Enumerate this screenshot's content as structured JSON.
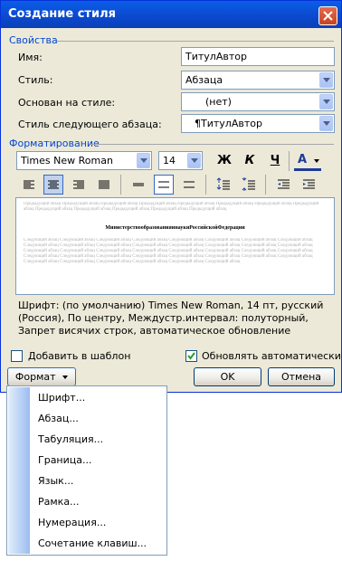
{
  "window": {
    "title": "Создание стиля"
  },
  "properties": {
    "section_title": "Свойства",
    "name_label": "Имя:",
    "name_value": "ТитулАвтор",
    "style_type_label": "Стиль:",
    "style_type_value": "Абзаца",
    "based_on_label": "Основан на стиле:",
    "based_on_value": "(нет)",
    "next_style_label": "Стиль следующего абзаца:",
    "next_style_value": "¶ТитулАвтор"
  },
  "formatting": {
    "section_title": "Форматирование",
    "font_name": "Times New Roman",
    "font_size": "14",
    "bold_label": "Ж",
    "italic_label": "К",
    "underline_label": "Ч",
    "color_label": "А"
  },
  "preview": {
    "prev_paragraph": "Предыдущий абзац Предыдущий абзац Предыдущий абзац Предыдущий абзац Предыдущий абзац Предыдущий абзац Предыдущий абзац Предыдущий абзац Предыдущий абзац Предыдущий абзац Предыдущий абзац Предыдущий абзац Предыдущий абзац",
    "sample_text": "МинистерствообразованияинаукиРоссийскойФедерации",
    "next_paragraph": "Следующий абзац Следующий абзац Следующий абзац Следующий абзац Следующий абзац Следующий абзац Следующий абзац Следующий абзац Следующий абзац Следующий абзац Следующий абзац Следующий абзац Следующий абзац Следующий абзац Следующий абзац Следующий абзац Следующий абзац Следующий абзац Следующий абзац Следующий абзац Следующий абзац Следующий абзац Следующий абзац Следующий абзац Следующий абзац Следующий абзац Следующий абзац Следующий абзац Следующий абзац Следующий абзац Следующий абзац Следующий абзац Следующий абзац Следующий абзац Следующий абзац Следующий абзац Следующий абзац Следующий абзац"
  },
  "description": "Шрифт: (по умолчанию) Times New Roman, 14 пт, русский (Россия), По центру, Междустр.интервал:  полуторный, Запрет висячих строк, автоматическое обновление",
  "options": {
    "add_to_template_label": "Добавить в шаблон",
    "add_to_template_checked": false,
    "auto_update_label": "Обновлять автоматически",
    "auto_update_checked": true
  },
  "buttons": {
    "format": "Формат",
    "ok": "OK",
    "cancel": "Отмена"
  },
  "format_menu": {
    "items": [
      "Шрифт...",
      "Абзац...",
      "Табуляция...",
      "Граница...",
      "Язык...",
      "Рамка...",
      "Нумерация...",
      "Сочетание клавиш..."
    ]
  }
}
